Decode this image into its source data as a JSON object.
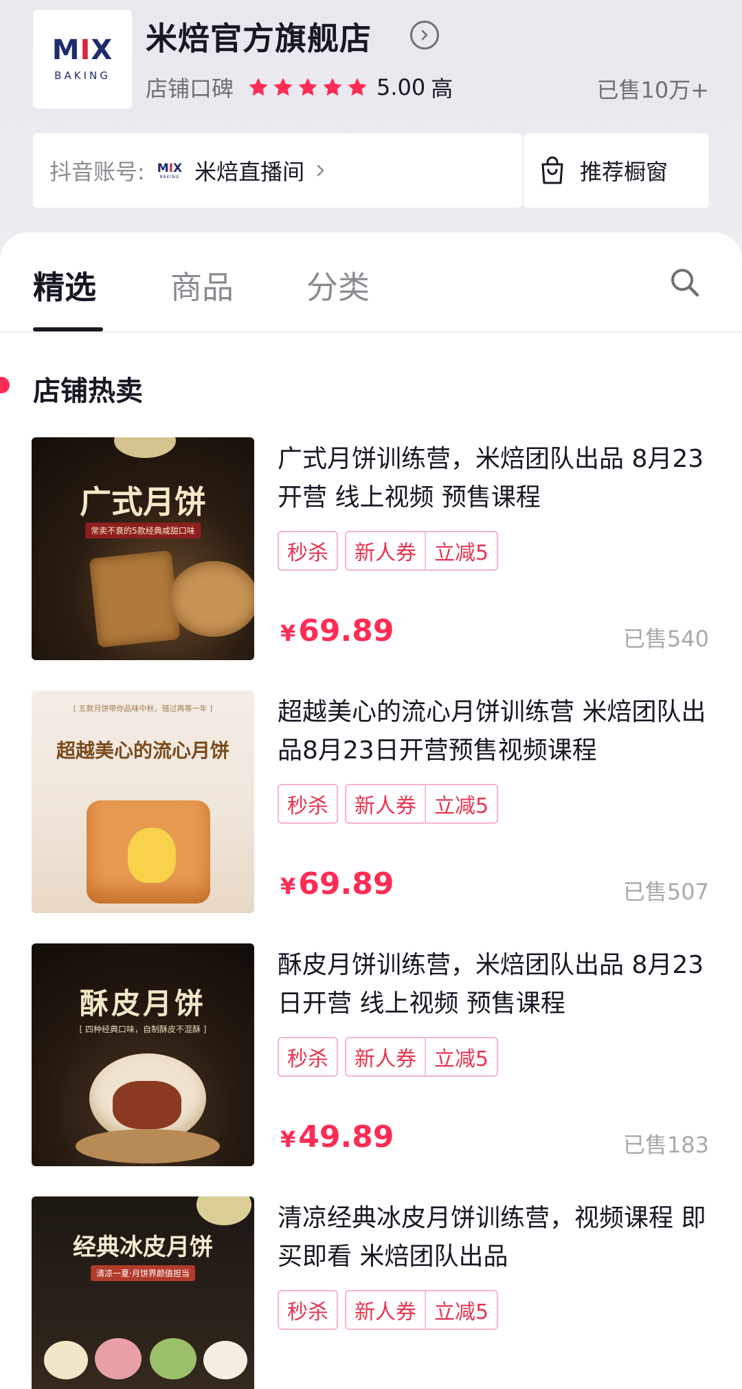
{
  "store": {
    "name": "米焙官方旗舰店",
    "logo_text": "MIX",
    "logo_sub": "BAKING",
    "rating_label": "店铺口碑",
    "rating_stars": 5,
    "rating_score": "5.00",
    "rating_level": "高",
    "sold_total": "已售10万+"
  },
  "douyin": {
    "label": "抖音账号:",
    "name": "米焙直播间"
  },
  "showcase": {
    "label": "推荐橱窗"
  },
  "tabs": [
    {
      "label": "精选",
      "active": true
    },
    {
      "label": "商品",
      "active": false
    },
    {
      "label": "分类",
      "active": false
    }
  ],
  "section": {
    "title": "店铺热卖"
  },
  "products": [
    {
      "title": "广式月饼训练营，米焙团队出品 8月23开营 线上视频 预售课程",
      "thumb_title": "广式月饼",
      "thumb_sub": "常卖不衰的5款经典咸甜口味",
      "tags": {
        "flash": "秒杀",
        "newuser": "新人券",
        "discount": "立减5"
      },
      "currency": "¥",
      "price": "69.89",
      "sold": "已售540"
    },
    {
      "title": "超越美心的流心月饼训练营 米焙团队出品8月23日开营预售视频课程",
      "thumb_title": "超越美心的流心月饼",
      "thumb_sub": "[ 五款月饼带你品味中秋，错过再等一年 ]",
      "tags": {
        "flash": "秒杀",
        "newuser": "新人券",
        "discount": "立减5"
      },
      "currency": "¥",
      "price": "69.89",
      "sold": "已售507"
    },
    {
      "title": "酥皮月饼训练营，米焙团队出品 8月23日开营 线上视频 预售课程",
      "thumb_title": "酥皮月饼",
      "thumb_sub": "[ 四种经典口味，自制酥皮不混酥 ]",
      "tags": {
        "flash": "秒杀",
        "newuser": "新人券",
        "discount": "立减5"
      },
      "currency": "¥",
      "price": "49.89",
      "sold": "已售183"
    },
    {
      "title": "清凉经典冰皮月饼训练营，视频课程 即买即看 米焙团队出品",
      "thumb_title": "经典冰皮月饼",
      "thumb_sub": "清凉一夏·月饼界颜值担当",
      "tags": {
        "flash": "秒杀",
        "newuser": "新人券",
        "discount": "立减5"
      },
      "currency": "¥",
      "price": "",
      "sold": ""
    }
  ],
  "colors": {
    "accent": "#fe2c55",
    "tag": "#e8334f",
    "brand_navy": "#1e2c6b",
    "star": "#fe2c55"
  }
}
